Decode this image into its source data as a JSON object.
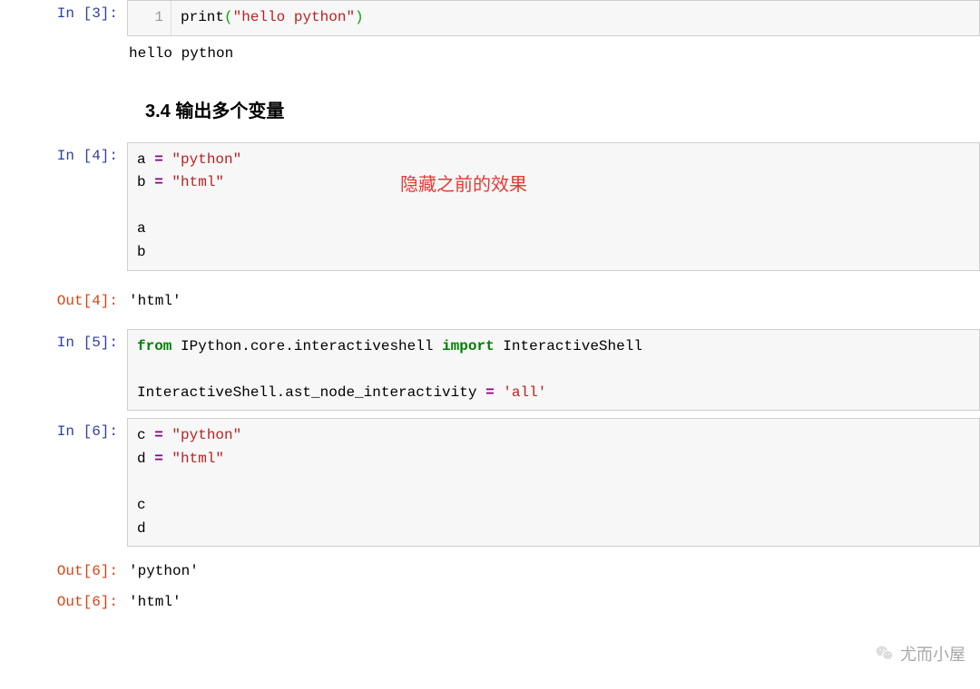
{
  "cells": {
    "c3": {
      "in_prompt": "In [3]:",
      "gutter": "1",
      "code": {
        "fn": "print",
        "lp": "(",
        "str": "\"hello python\"",
        "rp": ")"
      },
      "stdout": "hello python"
    },
    "heading34": "3.4  输出多个变量",
    "c4": {
      "in_prompt": "In [4]:",
      "code": {
        "l1a": "a ",
        "l1op": "=",
        "l1s": " \"python\"",
        "l2a": "b ",
        "l2op": "=",
        "l2s": " \"html\"",
        "blank": "",
        "l3": "a",
        "l4": "b"
      },
      "annotation": "隐藏之前的效果",
      "out_prompt": "Out[4]:",
      "out_value": "'html'"
    },
    "c5": {
      "in_prompt": "In [5]:",
      "code": {
        "kw_from": "from",
        "sp1": " ",
        "mod": "IPython.core.interactiveshell",
        "sp2": " ",
        "kw_import": "import",
        "sp3": " ",
        "cls": "InteractiveShell",
        "blank": "",
        "l2a": "InteractiveShell.ast_node_interactivity ",
        "l2op": "=",
        "l2s": " 'all'"
      }
    },
    "c6": {
      "in_prompt": "In [6]:",
      "code": {
        "l1a": "c ",
        "l1op": "=",
        "l1s": " \"python\"",
        "l2a": "d ",
        "l2op": "=",
        "l2s": " \"html\"",
        "blank": "",
        "l3": "c",
        "l4": "d"
      },
      "out1_prompt": "Out[6]:",
      "out1_value": "'python'",
      "out2_prompt": "Out[6]:",
      "out2_value": "'html'"
    }
  },
  "watermark": "尤而小屋"
}
